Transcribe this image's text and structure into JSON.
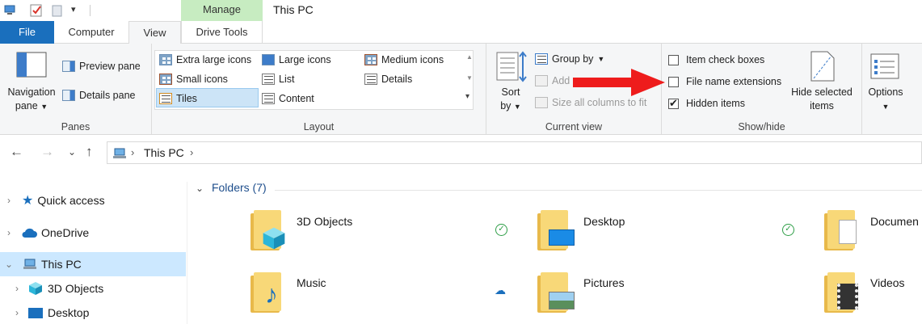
{
  "window": {
    "title": "This PC",
    "contextual_tab": "Manage"
  },
  "tabs": {
    "file": "File",
    "computer": "Computer",
    "view": "View",
    "drive_tools": "Drive Tools"
  },
  "ribbon": {
    "panes": {
      "label": "Panes",
      "navigation_pane": "Navigation",
      "navigation_pane_2": "pane",
      "preview_pane": "Preview pane",
      "details_pane": "Details pane"
    },
    "layout": {
      "label": "Layout",
      "extra_large_icons": "Extra large icons",
      "large_icons": "Large icons",
      "medium_icons": "Medium icons",
      "small_icons": "Small icons",
      "list": "List",
      "details": "Details",
      "tiles": "Tiles",
      "content": "Content"
    },
    "current_view": {
      "label": "Current view",
      "sort_by": "Sort",
      "sort_by_2": "by",
      "group_by": "Group by",
      "add_columns": "Add",
      "size_all_columns": "Size all columns to fit"
    },
    "show_hide": {
      "label": "Show/hide",
      "item_check_boxes": "Item check boxes",
      "file_name_extensions": "File name extensions",
      "hidden_items": "Hidden items",
      "hide_selected": "Hide selected",
      "hide_selected_2": "items",
      "item_check_boxes_checked": false,
      "file_name_extensions_checked": false,
      "hidden_items_checked": true
    },
    "options": {
      "label": "Options"
    }
  },
  "address_bar": {
    "path": "This PC"
  },
  "sidebar": {
    "items": [
      {
        "label": "Quick access"
      },
      {
        "label": "OneDrive"
      },
      {
        "label": "This PC"
      },
      {
        "label": "3D Objects"
      },
      {
        "label": "Desktop"
      }
    ]
  },
  "content": {
    "section_title": "Folders (7)",
    "folders": [
      {
        "name": "3D Objects"
      },
      {
        "name": "Desktop"
      },
      {
        "name": "Documen"
      },
      {
        "name": "Music"
      },
      {
        "name": "Pictures"
      },
      {
        "name": "Videos"
      }
    ]
  },
  "colors": {
    "accent": "#1a6fbd",
    "manage_tab": "#c7ecc1",
    "arrow": "#ee1c1c",
    "selection": "#cce8ff"
  }
}
